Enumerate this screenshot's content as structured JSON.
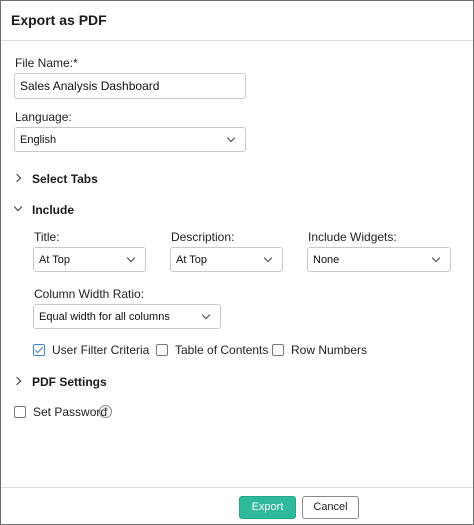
{
  "dialog": {
    "title": "Export as PDF"
  },
  "file_name": {
    "label": "File Name:*",
    "value": "Sales Analysis Dashboard"
  },
  "language": {
    "label": "Language:",
    "selected": "English"
  },
  "sections": {
    "select_tabs": "Select Tabs",
    "include": "Include",
    "pdf_settings": "PDF Settings"
  },
  "include": {
    "title": {
      "label": "Title:",
      "selected": "At Top"
    },
    "description": {
      "label": "Description:",
      "selected": "At Top"
    },
    "include_widgets": {
      "label": "Include Widgets:",
      "selected": "None"
    },
    "column_width_ratio": {
      "label": "Column Width Ratio:",
      "selected": "Equal width for all columns"
    },
    "options": [
      {
        "label": "User Filter Criteria",
        "checked": true
      },
      {
        "label": "Table of Contents",
        "checked": false
      },
      {
        "label": "Row Numbers",
        "checked": false
      }
    ]
  },
  "set_password": {
    "label": "Set Password",
    "checked": false,
    "help_icon": "?"
  },
  "footer": {
    "export_label": "Export",
    "cancel_label": "Cancel"
  },
  "colors": {
    "primary": "#2eb99a",
    "checkbox_accent": "#3b86c8",
    "border": "#c8c8c8"
  }
}
